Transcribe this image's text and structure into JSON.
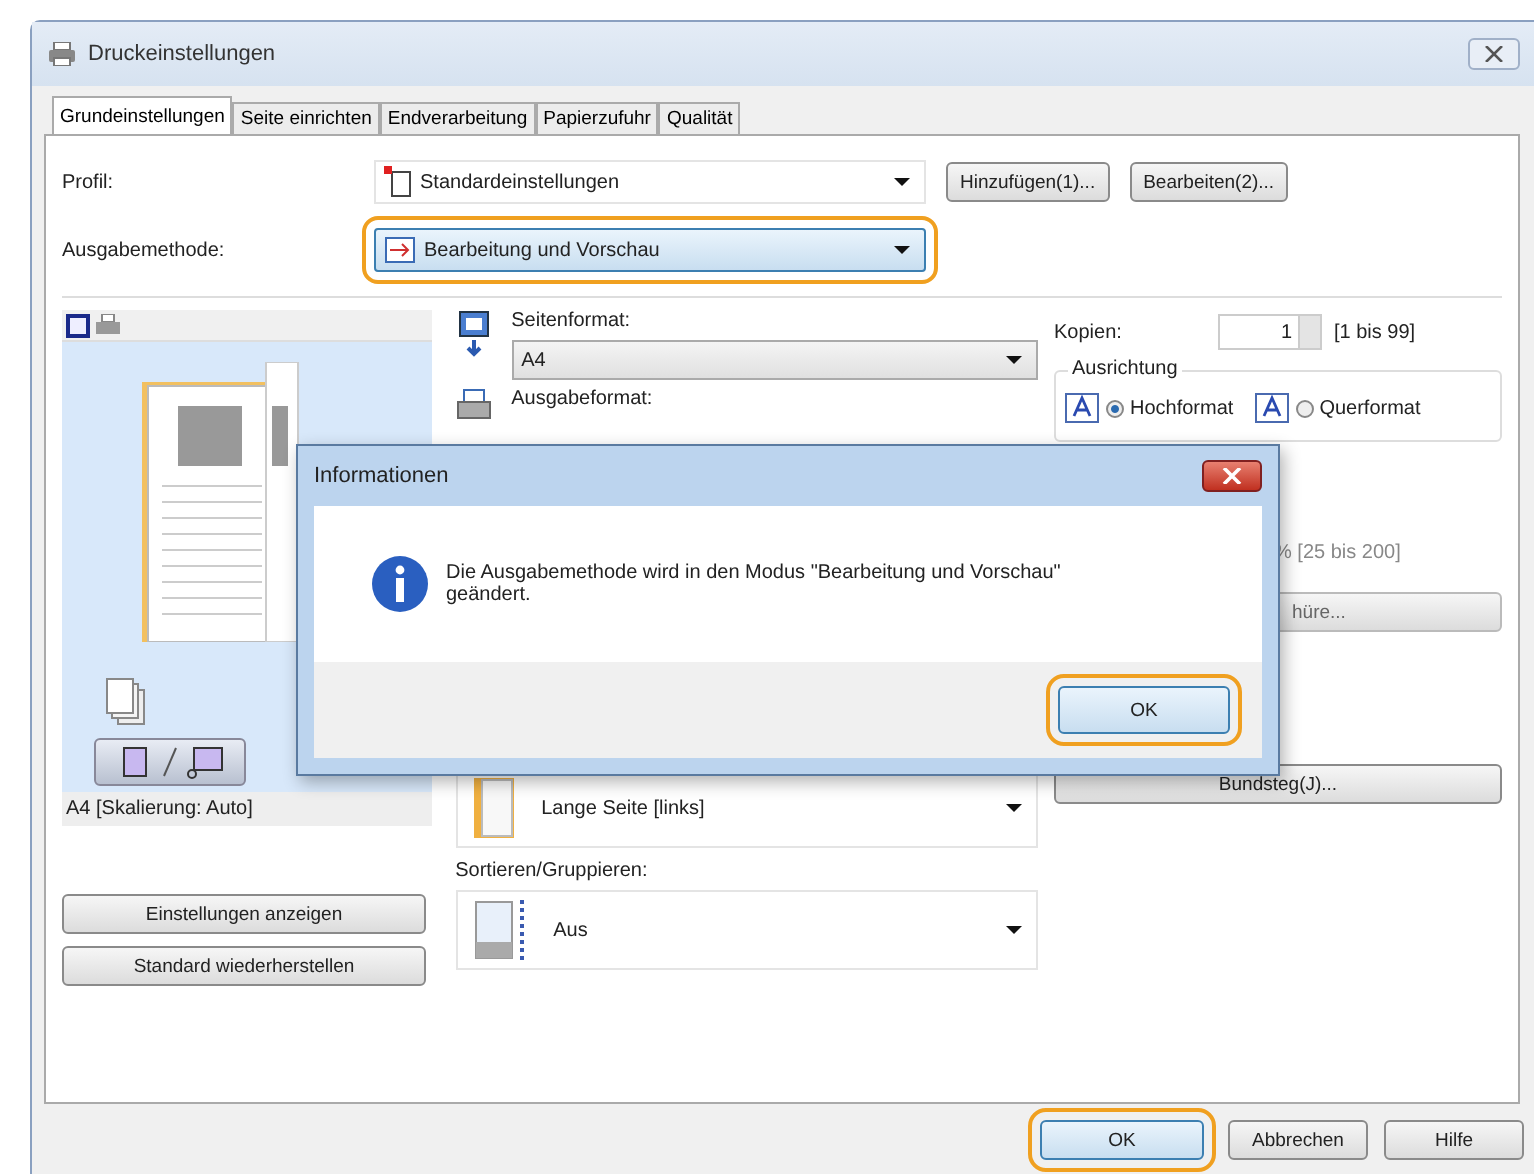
{
  "window": {
    "title": "Druckeinstellungen"
  },
  "tabs": [
    {
      "label": "Grundeinstellungen",
      "selected": true
    },
    {
      "label": "Seite einrichten",
      "selected": false
    },
    {
      "label": "Endverarbeitung",
      "selected": false
    },
    {
      "label": "Papierzufuhr",
      "selected": false
    },
    {
      "label": "Qualität",
      "selected": false
    }
  ],
  "profile": {
    "label": "Profil:",
    "value": "Standardeinstellungen",
    "buttons": [
      "Hinzufügen(1)...",
      "Bearbeiten(2)..."
    ]
  },
  "output_method": {
    "label": "Ausgabemethode:",
    "value": "Bearbeitung und Vorschau",
    "highlighted": true
  },
  "preview": {
    "caption": "A4 [Skalierung: Auto]",
    "buttons": [
      "Einstellungen anzeigen",
      "Standard wiederherstellen"
    ]
  },
  "page_size": {
    "label": "Seitenformat:",
    "value": "A4"
  },
  "output_size": {
    "label": "Ausgabeformat:"
  },
  "binding": {
    "value": "Lange Seite [links]"
  },
  "collate": {
    "label": "Sortieren/Gruppieren:",
    "value": "Aus"
  },
  "copies": {
    "label": "Kopien:",
    "value": "1",
    "range": "[1 bis 99]"
  },
  "orientation": {
    "title": "Ausrichtung",
    "options": [
      {
        "label": "Hochformat",
        "selected": true
      },
      {
        "label": "Querformat",
        "selected": false
      }
    ]
  },
  "scaling": {
    "range": "% [25 bis 200]"
  },
  "booklet_button": "hüre...",
  "gutter_button": "Bundsteg(J)...",
  "dialog": {
    "title": "Informationen",
    "message": "Die Ausgabemethode wird in den Modus \"Bearbeitung und Vorschau\" geändert.",
    "button": "OK",
    "highlighted": true
  },
  "buttons": [
    {
      "label": "OK",
      "highlighted": true
    },
    {
      "label": "Abbrechen",
      "highlighted": false
    },
    {
      "label": "Hilfe",
      "highlighted": false
    }
  ]
}
